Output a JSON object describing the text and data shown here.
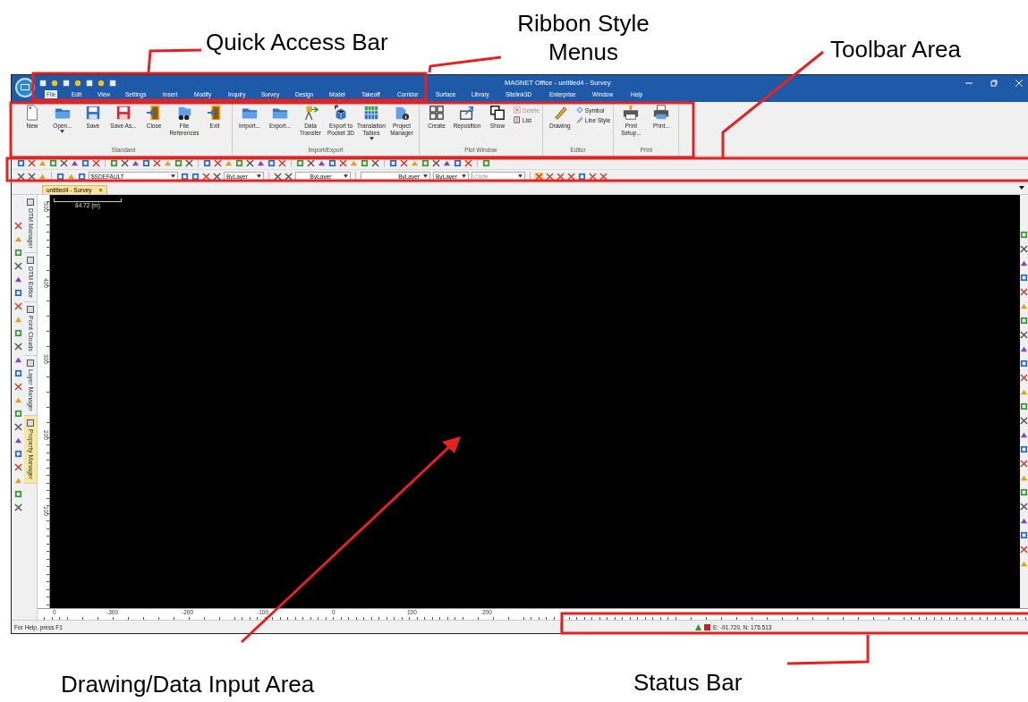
{
  "callouts": [
    {
      "text": "Quick Access Bar"
    },
    {
      "text": "Ribbon Style Menus"
    },
    {
      "text": "Toolbar Area"
    },
    {
      "text": "Drawing/Data Input Area"
    },
    {
      "text": "Status Bar"
    }
  ],
  "window": {
    "title": "MAGNET Office - untitled4 - Survey"
  },
  "menu_tabs": [
    {
      "label": "File",
      "selected": true
    },
    {
      "label": "Edit",
      "selected": false
    },
    {
      "label": "View",
      "selected": false
    },
    {
      "label": "Settings",
      "selected": false
    },
    {
      "label": "Insert",
      "selected": false
    },
    {
      "label": "Modify",
      "selected": false
    },
    {
      "label": "Inquiry",
      "selected": false
    },
    {
      "label": "Survey",
      "selected": false
    },
    {
      "label": "Design",
      "selected": false
    },
    {
      "label": "Model",
      "selected": false
    },
    {
      "label": "Takeoff",
      "selected": false
    },
    {
      "label": "Corridor",
      "selected": false
    },
    {
      "label": "Surface",
      "selected": false
    },
    {
      "label": "Library",
      "selected": false
    },
    {
      "label": "Sitelink3D",
      "selected": false
    },
    {
      "label": "Enterprise",
      "selected": false
    },
    {
      "label": "Window",
      "selected": false
    },
    {
      "label": "Help",
      "selected": false
    }
  ],
  "ribbon_groups": [
    {
      "label": "Standard",
      "buttons": [
        {
          "label": "New",
          "kind": "large"
        },
        {
          "label": "Open...",
          "kind": "menu"
        },
        {
          "label": "Save",
          "kind": "large"
        },
        {
          "label": "Save As...",
          "kind": "large"
        },
        {
          "label": "Close",
          "kind": "large"
        },
        {
          "label": "File References",
          "kind": "large"
        },
        {
          "label": "Exit",
          "kind": "large"
        }
      ]
    },
    {
      "label": "Import/Export",
      "buttons": [
        {
          "label": "Import...",
          "kind": "large"
        },
        {
          "label": "Export...",
          "kind": "large"
        },
        {
          "label": "Data Transfer",
          "kind": "large"
        },
        {
          "label": "Export to Pocket 3D",
          "kind": "large"
        },
        {
          "label": "Translation Tables",
          "kind": "menu"
        },
        {
          "label": "Project Manager",
          "kind": "large"
        }
      ]
    },
    {
      "label": "Plot Window",
      "buttons": [
        {
          "label": "Create",
          "kind": "large"
        },
        {
          "label": "Reposition",
          "kind": "large"
        },
        {
          "label": "Show",
          "kind": "large"
        },
        {
          "label": "Delete",
          "kind": "small",
          "disabled": true
        },
        {
          "label": "List",
          "kind": "small",
          "disabled": false
        }
      ]
    },
    {
      "label": "Editor",
      "buttons": [
        {
          "label": "Drawing",
          "kind": "large"
        },
        {
          "label": "Symbol",
          "kind": "small",
          "disabled": false
        },
        {
          "label": "Line Style",
          "kind": "small",
          "disabled": false
        }
      ]
    },
    {
      "label": "Print",
      "buttons": [
        {
          "label": "Print Setup...",
          "kind": "large"
        },
        {
          "label": "Print...",
          "kind": "large"
        }
      ]
    }
  ],
  "property_toolbar": {
    "layer": "$SDEFAULT",
    "color_dropdown": "ByLayer",
    "linetype_value": "ByLayer",
    "line_style": "ByLayer",
    "line_weight": "ByLayer",
    "code_placeholder": "Code"
  },
  "document_tabs": [
    {
      "label": "untitled4 - Survey",
      "selected": true,
      "close": "×"
    }
  ],
  "side_panels": [
    {
      "label": "DTM Manager",
      "selected": false
    },
    {
      "label": "DTM Editor",
      "selected": false
    },
    {
      "label": "Point Clouds",
      "selected": false
    },
    {
      "label": "Layer Manager",
      "selected": false
    },
    {
      "label": "Property Manager",
      "selected": true
    }
  ],
  "scale_bar": "84.72  (m)",
  "vertical_ruler": [
    "500",
    "400",
    "300",
    "200",
    "100"
  ],
  "horizontal_ruler": [
    "0",
    "-300",
    "-200",
    "-100",
    "0",
    "100",
    "200"
  ],
  "status_bar": {
    "help": "For Help, press F1",
    "coordinates": "E: -91.720, N: 175.513"
  }
}
